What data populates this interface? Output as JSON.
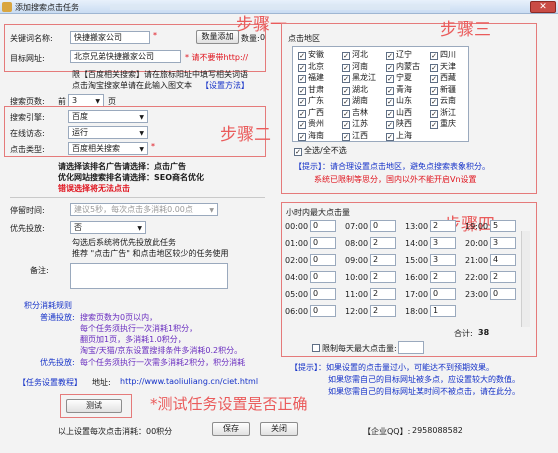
{
  "window": {
    "title": "添加搜索点击任务"
  },
  "form": {
    "keyword_label": "关键词名称:",
    "keyword_value": "快捷搬家公司",
    "keyword_required": "*",
    "query_button": "数量添加",
    "count_label": "数量:",
    "count_value": "0",
    "url_label": "目标网址:",
    "url_value": "北京兄弟快捷搬家公司",
    "url_note": "* 请不要带http://",
    "url_hint_line1": "限【百度相关搜索】请在旅标阳址中填写相关词语",
    "url_hint_line2": "点击淘宝搜家单请在此输入图文本",
    "url_hint_link": "【设置方法】",
    "pages_label": "搜索页数:",
    "pages_prefix": "前",
    "pages_value": "3",
    "pages_suffix": "页",
    "engine_label": "搜索引擎:",
    "engine_value": "百度",
    "browser_label": "在线访态:",
    "browser_value": "运行",
    "click_type_label": "点击类型:",
    "click_type_value": "百度相关搜索",
    "warn_line1": "请选择该排名广告请选择：点击广告",
    "warn_line2": "优化网站搜索排名请选择：SEO商名优化",
    "warn_line3": "错误选择将无法点击",
    "stay_label": "停留时间:",
    "stay_value": "建议5秒，每次点击多消耗0.00点",
    "priority_label": "优先投放:",
    "priority_value": "否",
    "priority_hint1": "勾选后系统将优先投放此任务",
    "priority_hint2": "推荐 \"点击广告\" 和点击地区较少的任务使用",
    "remark_label": "备注:",
    "remark_value": ""
  },
  "rules": {
    "heading": "积分消耗规则",
    "normal_label": "普通投放:",
    "normal_lines": [
      "搜索页数为0页以内，",
      "每个任务须执行一次消耗1积分，",
      "翻页加1页，多消耗1.0积分，",
      "淘宝/天猫/京东设置搜排条件多消耗0.2积分。",
      "每个任务须执行一次需多消耗2积分，积分消耗"
    ],
    "priority_label": "优先投放:",
    "tutorial_label": "【任务设置教程】",
    "address_label": "地址:",
    "address_value": "http://www.taoliuliang.cn/ciet.html"
  },
  "bottom": {
    "test_button": "测试",
    "estimate_label": "以上设置每次点击消耗：00积分",
    "save_button": "保存",
    "close_button": "关闭",
    "qq_label": "【企业QQ】:",
    "qq_value": "2958088582"
  },
  "annotations": {
    "step1": "步骤一",
    "step2": "步骤二",
    "step3": "步骤三",
    "step4": "步骤四",
    "test_note": "*测试任务设置是否正确"
  },
  "region_panel": {
    "title": "点击地区",
    "columns": [
      [
        "安徽",
        "北京",
        "福建",
        "甘肃",
        "广东",
        "广西",
        "贵州",
        "海南"
      ],
      [
        "河北",
        "河南",
        "黑龙江",
        "湖北",
        "湖南",
        "吉林",
        "江苏",
        "江西"
      ],
      [
        "辽宁",
        "内蒙古",
        "宁夏",
        "青海",
        "山东",
        "山西",
        "陕西",
        "上海"
      ],
      [
        "四川",
        "天津",
        "西藏",
        "新疆",
        "云南",
        "浙江",
        "重庆"
      ]
    ],
    "select_all": "全选/全不选",
    "tip_line1": "【提示】：请合理设置点击地区，避免点搜索表象积分。",
    "tip_line2": "系统已限制等思分，国内以外不能开启Vn设置"
  },
  "hourly": {
    "title": "小时内最大点击量",
    "rows": [
      [
        [
          "00:00",
          "0"
        ],
        [
          "07:00",
          "0"
        ],
        [
          "13:00",
          "2"
        ],
        [
          "19:00",
          "5"
        ]
      ],
      [
        [
          "01:00",
          "0"
        ],
        [
          "08:00",
          "2"
        ],
        [
          "14:00",
          "3"
        ],
        [
          "20:00",
          "3"
        ]
      ],
      [
        [
          "02:00",
          "0"
        ],
        [
          "09:00",
          "2"
        ],
        [
          "15:00",
          "3"
        ],
        [
          "21:00",
          "4"
        ]
      ],
      [
        [
          "04:00",
          "0"
        ],
        [
          "10:00",
          "2"
        ],
        [
          "16:00",
          "2"
        ],
        [
          "22:00",
          "2"
        ]
      ],
      [
        [
          "05:00",
          "0"
        ],
        [
          "11:00",
          "2"
        ],
        [
          "17:00",
          "0"
        ],
        [
          "23:00",
          "0"
        ]
      ],
      [
        [
          "06:00",
          "0"
        ],
        [
          "12:00",
          "2"
        ],
        [
          "18:00",
          "1"
        ],
        [
          "",
          ""
        ]
      ]
    ],
    "total_label": "合计:",
    "total_value": "38",
    "daily_limit_label": "限制每天最大点击量:",
    "tips": [
      "【提示】：如果设置的点击量过小，可能达不到预期效果。",
      "如果您需自己的目标网址被多点，应设置较大的数值。",
      "如果您需自己的目标网址某时间不被点击，请在此分。"
    ]
  }
}
